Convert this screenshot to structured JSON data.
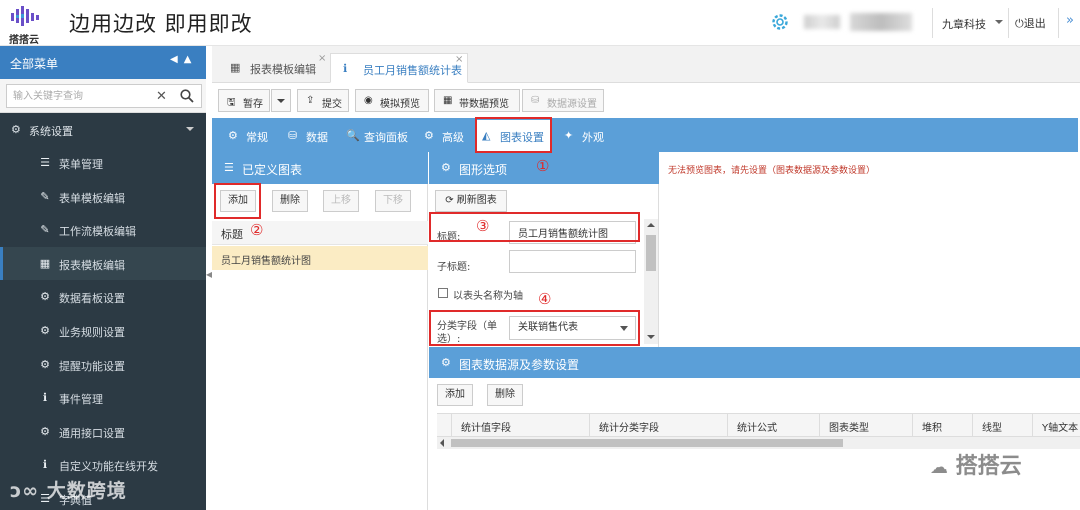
{
  "header": {
    "logo_text": "搭搭云",
    "slogan": "边用边改  即用即改",
    "company": "九章科技",
    "logout": "退出"
  },
  "sidebar": {
    "title": "全部菜单",
    "search_placeholder": "输入关键字查询",
    "group": "系统设置",
    "items": [
      {
        "label": "菜单管理",
        "icon": "list-icon"
      },
      {
        "label": "表单模板编辑",
        "icon": "edit-icon"
      },
      {
        "label": "工作流模板编辑",
        "icon": "edit-icon"
      },
      {
        "label": "报表模板编辑",
        "icon": "table-icon",
        "active": true
      },
      {
        "label": "数据看板设置",
        "icon": "gear-icon"
      },
      {
        "label": "业务规则设置",
        "icon": "gear-icon"
      },
      {
        "label": "提醒功能设置",
        "icon": "gear-icon"
      },
      {
        "label": "事件管理",
        "icon": "info-icon"
      },
      {
        "label": "通用接口设置",
        "icon": "gear-icon"
      },
      {
        "label": "自定义功能在线开发",
        "icon": "info-icon"
      },
      {
        "label": "字典值",
        "icon": "list-icon"
      }
    ]
  },
  "page_tabs": [
    {
      "label": "报表模板编辑",
      "icon": "table-icon",
      "active": false
    },
    {
      "label": "员工月销售额统计表",
      "icon": "info-icon",
      "active": true
    }
  ],
  "toolbar": {
    "save": "暂存",
    "submit": "提交",
    "simulate_preview": "模拟预览",
    "data_preview": "带数据预览",
    "datasource_settings": "数据源设置"
  },
  "settings_tabs": [
    {
      "label": "常规",
      "icon": "gear-icon"
    },
    {
      "label": "数据",
      "icon": "database-icon"
    },
    {
      "label": "查询面板",
      "icon": "search-icon"
    },
    {
      "label": "高级",
      "icon": "gears-icon"
    },
    {
      "label": "图表设置",
      "icon": "area-chart-icon",
      "active": true
    },
    {
      "label": "外观",
      "icon": "magic-wand-icon"
    }
  ],
  "custom_charts": {
    "title": "已定义图表",
    "buttons": {
      "add": "添加",
      "delete": "删除",
      "up": "上移",
      "down": "下移"
    },
    "column_header": "标题",
    "rows": [
      "员工月销售额统计图"
    ]
  },
  "chart_options": {
    "title": "图形选项",
    "refresh": "刷新图表",
    "title_label": "标题:",
    "title_value": "员工月销售额统计图",
    "subtitle_label": "子标题:",
    "subtitle_value": "",
    "header_as_axis": "以表头名称为轴",
    "category_label": "分类字段（单选）:",
    "category_value": "关联销售代表"
  },
  "preview_message": "无法预览图表，请先设置（图表数据源及参数设置）",
  "datasource": {
    "title": "图表数据源及参数设置",
    "buttons": {
      "add": "添加",
      "delete": "删除"
    },
    "columns": [
      "统计值字段",
      "统计分类字段",
      "统计公式",
      "图表类型",
      "堆积",
      "线型",
      "Y轴文本"
    ]
  },
  "annotations": [
    "①",
    "②",
    "③",
    "④"
  ],
  "watermarks": {
    "left": "大数跨境",
    "right": "搭搭云"
  }
}
